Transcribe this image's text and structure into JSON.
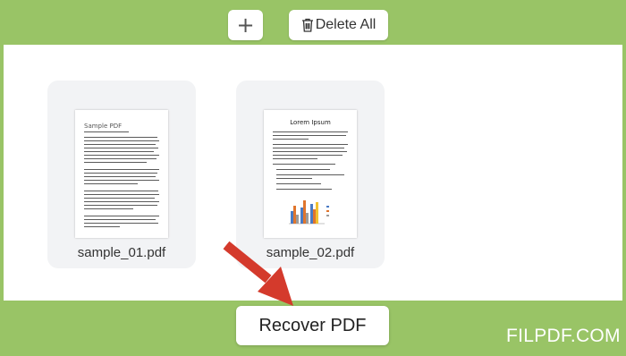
{
  "toolbar": {
    "add_label": "+",
    "delete_all_label": "Delete All"
  },
  "files": [
    {
      "name": "sample_01.pdf",
      "doc_title": "Sample PDF"
    },
    {
      "name": "sample_02.pdf",
      "doc_title": "Lorem Ipsum"
    }
  ],
  "footer": {
    "recover_label": "Recover PDF",
    "brand": "FILPDF.COM"
  },
  "colors": {
    "frame": "#99c466",
    "arrow": "#d43a2c",
    "card": "#f2f3f5"
  }
}
